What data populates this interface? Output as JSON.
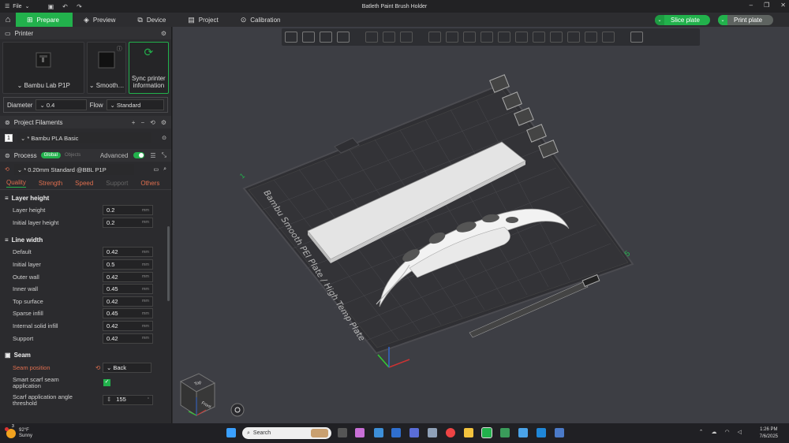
{
  "titlebar": {
    "menu_label": "File",
    "title": "Batleth Paint Brush Holder"
  },
  "tabs": [
    {
      "label": "Prepare"
    },
    {
      "label": "Preview"
    },
    {
      "label": "Device"
    },
    {
      "label": "Project"
    },
    {
      "label": "Calibration"
    }
  ],
  "actions": {
    "slice": "Slice plate",
    "print": "Print plate"
  },
  "printer": {
    "section_title": "Printer",
    "name": "Bambu Lab P1P",
    "plate": "Smooth…",
    "sync": "Sync printer information",
    "diameter_label": "Diameter",
    "diameter_value": "0.4",
    "flow_label": "Flow",
    "flow_value": "Standard"
  },
  "filaments": {
    "section_title": "Project Filaments",
    "items": [
      {
        "num": "1",
        "name": "* Bambu PLA Basic"
      }
    ]
  },
  "process": {
    "section_title": "Process",
    "global_label": "Global",
    "objects_label": "Objects",
    "advanced_label": "Advanced",
    "preset": "* 0.20mm Standard @BBL P1P",
    "subtabs": [
      "Quality",
      "Strength",
      "Speed",
      "Support",
      "Others"
    ]
  },
  "groups": {
    "layer_height": {
      "title": "Layer height",
      "rows": [
        {
          "label": "Layer height",
          "value": "0.2",
          "unit": "mm"
        },
        {
          "label": "Initial layer height",
          "value": "0.2",
          "unit": "mm"
        }
      ]
    },
    "line_width": {
      "title": "Line width",
      "rows": [
        {
          "label": "Default",
          "value": "0.42",
          "unit": "mm"
        },
        {
          "label": "Initial layer",
          "value": "0.5",
          "unit": "mm"
        },
        {
          "label": "Outer wall",
          "value": "0.42",
          "unit": "mm"
        },
        {
          "label": "Inner wall",
          "value": "0.45",
          "unit": "mm"
        },
        {
          "label": "Top surface",
          "value": "0.42",
          "unit": "mm"
        },
        {
          "label": "Sparse infill",
          "value": "0.45",
          "unit": "mm"
        },
        {
          "label": "Internal solid infill",
          "value": "0.42",
          "unit": "mm"
        },
        {
          "label": "Support",
          "value": "0.42",
          "unit": "mm"
        }
      ]
    },
    "seam": {
      "title": "Seam",
      "position_label": "Seam position",
      "position_value": "Back",
      "scarf_label_1": "Smart scarf seam",
      "scarf_label_2": "application",
      "angle_label_1": "Scarf application angle",
      "angle_label_2": "threshold",
      "angle_value": "155",
      "angle_unit": "°"
    }
  },
  "plate": {
    "label": "Bambu Smooth PEI Plate / High Temp Plate",
    "corner_1": "1",
    "corner_5": "5",
    "cube_top": "Top",
    "cube_front": "Front"
  },
  "taskbar": {
    "temp": "92°F",
    "condition": "Sunny",
    "badge": "3",
    "search": "Search",
    "time": "1:26 PM",
    "date": "7/6/2025"
  }
}
